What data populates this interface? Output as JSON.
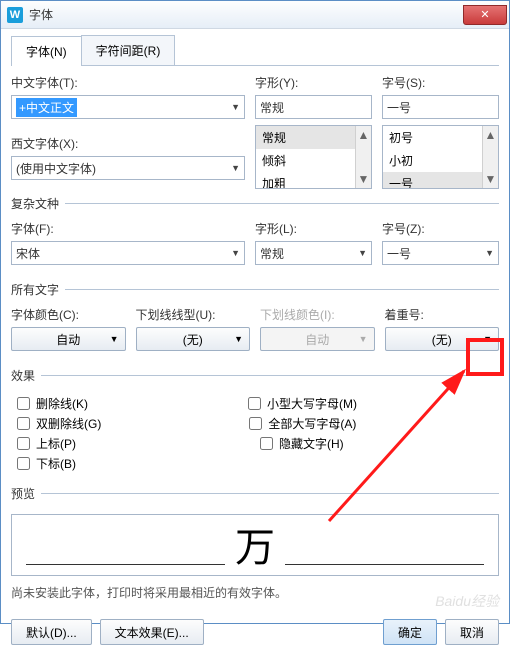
{
  "title": "字体",
  "tabs": {
    "font": "字体(N)",
    "spacing": "字符间距(R)"
  },
  "labels": {
    "cnFont": "中文字体(T):",
    "westFont": "西文字体(X):",
    "style": "字形(Y):",
    "size": "字号(S):",
    "complex": "复杂文种",
    "cfFont": "字体(F):",
    "cfStyle": "字形(L):",
    "cfSize": "字号(Z):",
    "allText": "所有文字",
    "fontColor": "字体颜色(C):",
    "underline": "下划线线型(U):",
    "ulColor": "下划线颜色(I):",
    "emphasis": "着重号:",
    "effects": "效果",
    "preview": "预览"
  },
  "values": {
    "cnFont": "+中文正文",
    "westFont": "(使用中文字体)",
    "style": "常规",
    "size": "一号",
    "cfFont": "宋体",
    "cfStyle": "常规",
    "cfSize": "一号",
    "fontColor": "自动",
    "underline": "(无)",
    "ulColor": "自动",
    "emphasis": "(无)"
  },
  "styleList": [
    "常规",
    "倾斜",
    "加粗"
  ],
  "sizeList": [
    "初号",
    "小初",
    "一号"
  ],
  "checks": {
    "strike": "删除线(K)",
    "dstrike": "双删除线(G)",
    "sup": "上标(P)",
    "sub": "下标(B)",
    "smallcaps": "小型大写字母(M)",
    "allcaps": "全部大写字母(A)",
    "hidden": "隐藏文字(H)"
  },
  "previewChar": "万",
  "note": "尚未安装此字体，打印时将采用最相近的有效字体。",
  "buttons": {
    "default": "默认(D)...",
    "textfx": "文本效果(E)...",
    "ok": "确定",
    "cancel": "取消"
  },
  "watermark": "Baidu经验"
}
